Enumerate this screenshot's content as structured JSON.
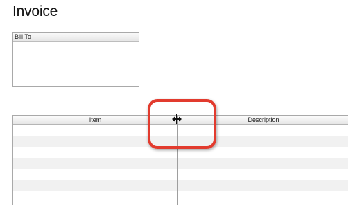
{
  "page": {
    "title": "Invoice"
  },
  "bill_to": {
    "label": "Bill To",
    "value": ""
  },
  "items_table": {
    "columns": [
      "Item",
      "Description"
    ],
    "rows": [
      [
        "",
        ""
      ],
      [
        "",
        ""
      ],
      [
        "",
        ""
      ],
      [
        "",
        ""
      ],
      [
        "",
        ""
      ],
      [
        "",
        ""
      ],
      [
        "",
        ""
      ]
    ]
  },
  "icons": {
    "cursor": "column-resize-cursor-icon"
  },
  "colors": {
    "highlight": "#e23b2e",
    "row_stripe": "#f1f1f1",
    "border": "#a9a9a9"
  }
}
